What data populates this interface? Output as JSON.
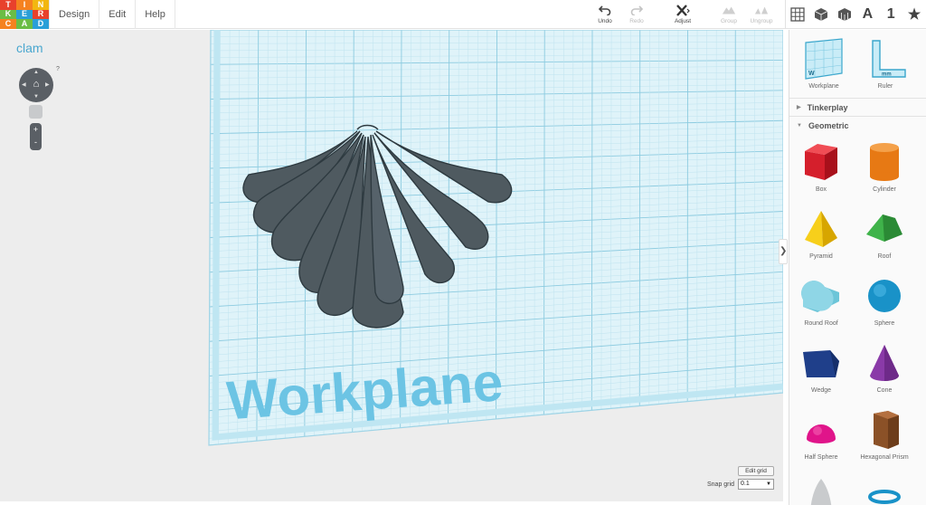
{
  "logo": {
    "letters": [
      "T",
      "I",
      "N",
      "K",
      "E",
      "R",
      "C",
      "A",
      "D"
    ],
    "colors": [
      "#e8412c",
      "#f58220",
      "#f2b711",
      "#6bbd45",
      "#2a9fd8",
      "#e8412c",
      "#f58220",
      "#6bbd45",
      "#2a9fd8"
    ]
  },
  "menu": {
    "items": [
      "Design",
      "Edit",
      "Help"
    ]
  },
  "toolbar": {
    "undo": "Undo",
    "redo": "Redo",
    "adjust": "Adjust",
    "group": "Group",
    "ungroup": "Ungroup"
  },
  "view": {
    "letter_a": "A",
    "number_1": "1",
    "star": "★"
  },
  "project": {
    "name": "clam"
  },
  "help": "?",
  "canvas": {
    "workplane_label": "Workplane",
    "edit_grid": "Edit grid",
    "snap_label": "Snap grid",
    "snap_value": "0.1"
  },
  "panel": {
    "helpers": [
      {
        "label": "Workplane",
        "icon": "workplane-icon"
      },
      {
        "label": "Ruler",
        "icon": "ruler-icon"
      }
    ],
    "categories": [
      "Tinkerplay",
      "Geometric"
    ],
    "shapes": [
      {
        "label": "Box",
        "icon": "box-icon"
      },
      {
        "label": "Cylinder",
        "icon": "cylinder-icon"
      },
      {
        "label": "Pyramid",
        "icon": "pyramid-icon"
      },
      {
        "label": "Roof",
        "icon": "roof-icon"
      },
      {
        "label": "Round Roof",
        "icon": "round-roof-icon"
      },
      {
        "label": "Sphere",
        "icon": "sphere-icon"
      },
      {
        "label": "Wedge",
        "icon": "wedge-icon"
      },
      {
        "label": "Cone",
        "icon": "cone-icon"
      },
      {
        "label": "Half Sphere",
        "icon": "half-sphere-icon"
      },
      {
        "label": "Hexagonal Prism",
        "icon": "hexagonal-prism-icon"
      }
    ]
  },
  "colors": {
    "accent": "#4aa7cf",
    "grid_bg": "#d9f1f7",
    "grid_line": "#9fd4e6",
    "shell": "#4f5a60"
  }
}
